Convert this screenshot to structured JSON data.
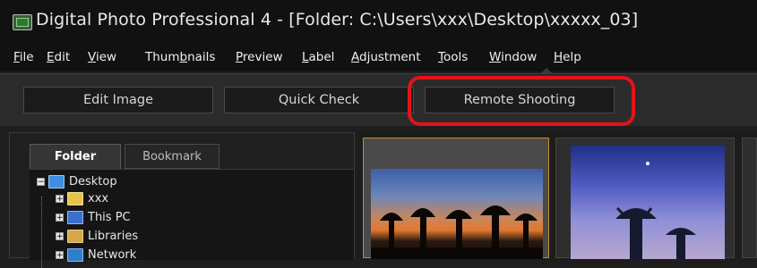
{
  "window": {
    "title": "Digital Photo Professional 4 - [Folder: C:\\Users\\xxx\\Desktop\\xxxxx_03]"
  },
  "menu": {
    "items": [
      {
        "pre": "",
        "u": "F",
        "post": "ile"
      },
      {
        "pre": "",
        "u": "E",
        "post": "dit"
      },
      {
        "pre": "",
        "u": "V",
        "post": "iew"
      },
      {
        "pre": "Thum",
        "u": "b",
        "post": "nails"
      },
      {
        "pre": "",
        "u": "P",
        "post": "review"
      },
      {
        "pre": "",
        "u": "L",
        "post": "abel"
      },
      {
        "pre": "",
        "u": "A",
        "post": "djustment"
      },
      {
        "pre": "",
        "u": "T",
        "post": "ools"
      },
      {
        "pre": "",
        "u": "W",
        "post": "indow"
      },
      {
        "pre": "",
        "u": "H",
        "post": "elp"
      }
    ]
  },
  "toolbar": {
    "edit_image": "Edit Image",
    "quick_check": "Quick Check",
    "remote_shooting": "Remote Shooting"
  },
  "panel": {
    "tab_folder": "Folder",
    "tab_bookmark": "Bookmark",
    "tree": [
      {
        "label": "Desktop",
        "icon": "desktop-icon",
        "expander": "−"
      },
      {
        "label": "xxx",
        "icon": "user-folder-icon",
        "expander": "+"
      },
      {
        "label": "This PC",
        "icon": "computer-icon",
        "expander": "+"
      },
      {
        "label": "Libraries",
        "icon": "libraries-icon",
        "expander": "+"
      },
      {
        "label": "Network",
        "icon": "network-icon",
        "expander": "+"
      }
    ]
  },
  "colors": {
    "highlight": "#e3121b",
    "selected_thumb_border": "#c58a2a"
  }
}
